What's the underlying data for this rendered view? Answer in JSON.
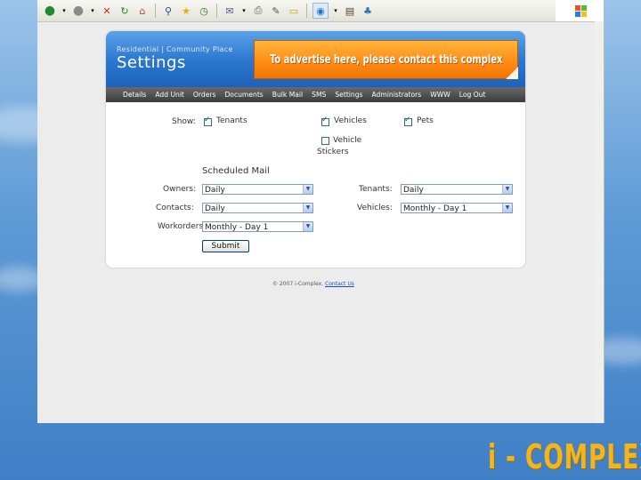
{
  "colors": {
    "accent_blue": "#2a76cf",
    "ad_orange": "#ff8a12",
    "nav_bg": "#3b3b3b",
    "brand_gold": "#f3b51d"
  },
  "browser": {
    "toolbar_icons": [
      "back-icon",
      "forward-icon",
      "stop-icon",
      "refresh-icon",
      "home-icon",
      "search-icon",
      "favorites-icon",
      "history-icon",
      "mail-icon",
      "print-icon",
      "edit-icon",
      "discuss-icon",
      "messenger-icon",
      "research-icon",
      "users-icon"
    ]
  },
  "header": {
    "breadcrumb": "Residential | Community Place",
    "title": "Settings",
    "ad_text": "To advertise here, please contact this complex"
  },
  "nav": {
    "items": [
      "Details",
      "Add Unit",
      "Orders",
      "Documents",
      "Bulk Mail",
      "SMS",
      "Settings",
      "Administrators",
      "WWW",
      "Log Out"
    ]
  },
  "show": {
    "label": "Show:",
    "options": [
      {
        "label": "Tenants",
        "checked": true
      },
      {
        "label": "Vehicles",
        "checked": true
      },
      {
        "label": "Pets",
        "checked": true
      },
      {
        "label": "Vehicle Stickers",
        "checked": false
      }
    ]
  },
  "scheduled": {
    "heading": "Scheduled Mail",
    "owners": {
      "label": "Owners:",
      "value": "Daily"
    },
    "contacts": {
      "label": "Contacts:",
      "value": "Daily"
    },
    "workorders": {
      "label": "Workorders:",
      "value": "Monthly - Day 1"
    },
    "tenants": {
      "label": "Tenants:",
      "value": "Daily"
    },
    "vehicles": {
      "label": "Vehicles:",
      "value": "Monthly - Day 1"
    },
    "submit": "Submit"
  },
  "footer": {
    "text": "© 2007 i-Complex.",
    "link": "Contact Us"
  },
  "brand": "i - COMPLEX"
}
